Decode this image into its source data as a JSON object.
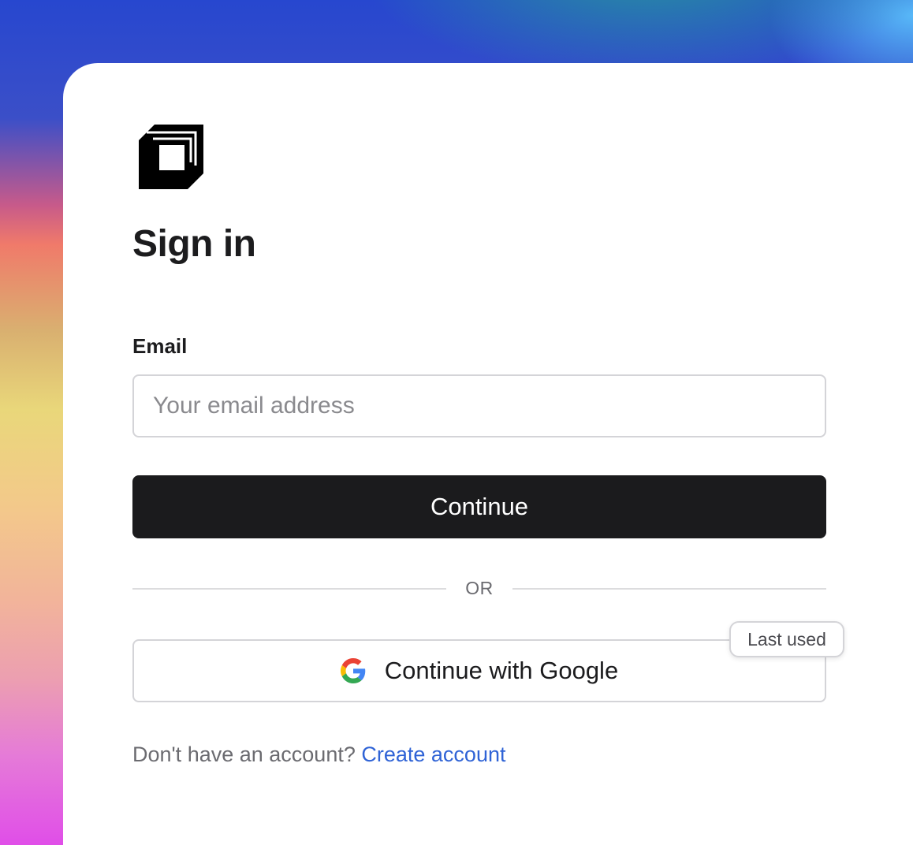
{
  "page": {
    "title": "Sign in"
  },
  "form": {
    "email_label": "Email",
    "email_placeholder": "Your email address",
    "email_value": "",
    "continue_label": "Continue"
  },
  "divider": {
    "text": "OR"
  },
  "google": {
    "label": "Continue with Google",
    "icon": "google-icon",
    "badge": "Last used"
  },
  "footer": {
    "prompt": "Don't have an account?",
    "link_label": "Create account"
  },
  "colors": {
    "primary_button": "#1b1b1d",
    "link": "#2f63d6",
    "border": "#d4d4d8"
  }
}
